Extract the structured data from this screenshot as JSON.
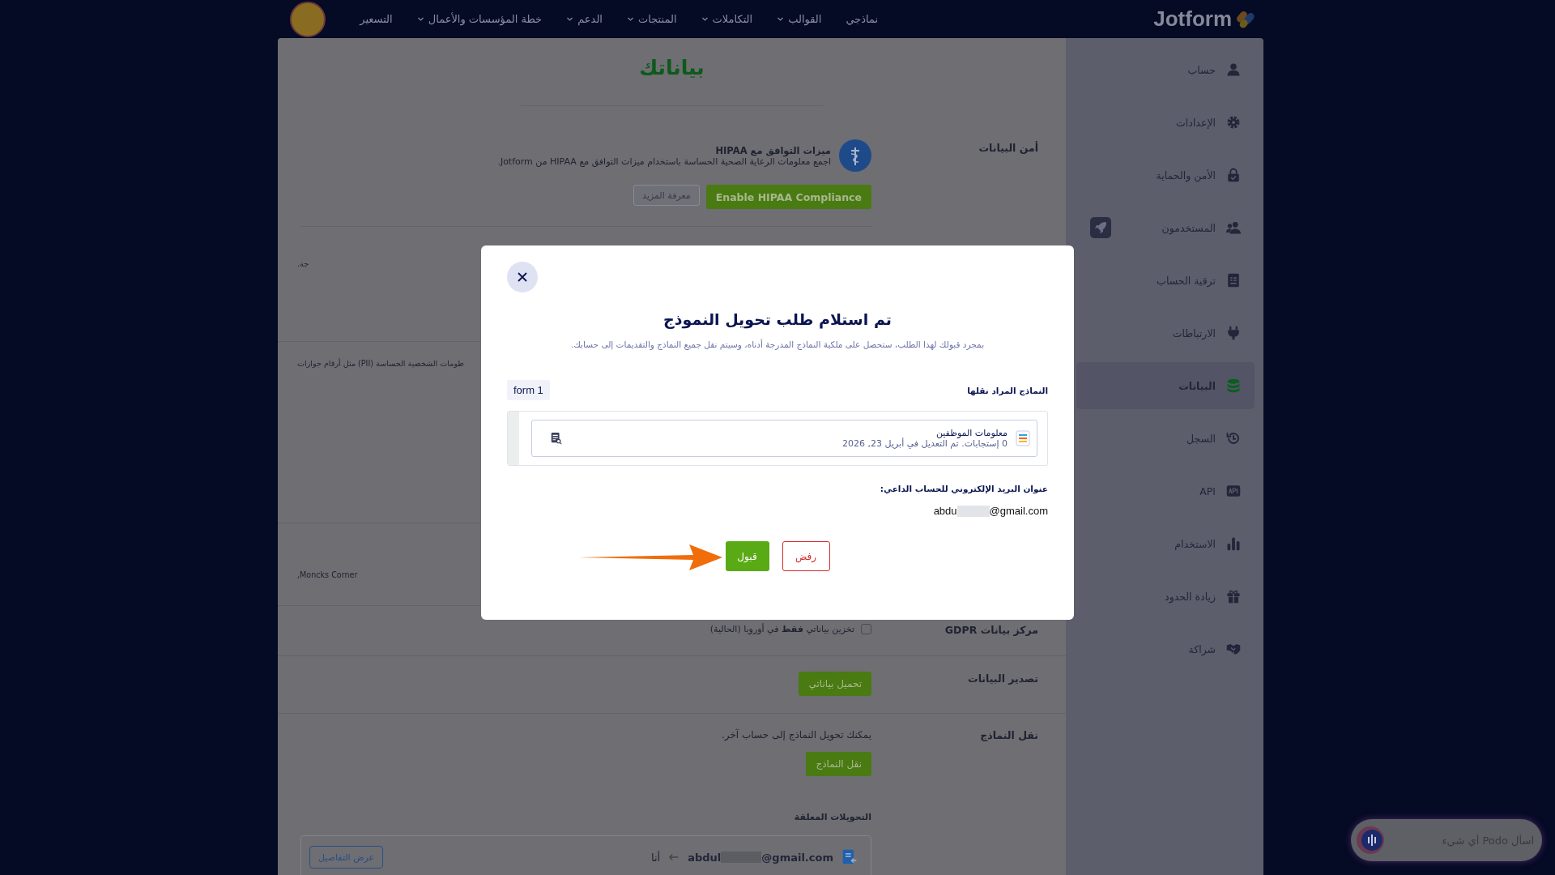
{
  "nav": {
    "logo": "Jotform",
    "items": [
      {
        "label": "نماذجي",
        "dropdown": false
      },
      {
        "label": "القوالب",
        "dropdown": true
      },
      {
        "label": "التكاملات",
        "dropdown": true
      },
      {
        "label": "المنتجات",
        "dropdown": true
      },
      {
        "label": "الدعم",
        "dropdown": true
      },
      {
        "label": "خطة المؤسسات والأعمال",
        "dropdown": true
      },
      {
        "label": "التسعير",
        "dropdown": false
      }
    ]
  },
  "sidebar": {
    "items": [
      {
        "label": "حساب",
        "selected": false,
        "upgrade_badge": false
      },
      {
        "label": "الإعدادات",
        "selected": false,
        "upgrade_badge": false
      },
      {
        "label": "الأمن والحماية",
        "selected": false,
        "upgrade_badge": false
      },
      {
        "label": "المستخدمون",
        "selected": false,
        "upgrade_badge": true
      },
      {
        "label": "ترقية الحساب",
        "selected": false,
        "upgrade_badge": false
      },
      {
        "label": "الارتباطات",
        "selected": false,
        "upgrade_badge": false
      },
      {
        "label": "البيانات",
        "selected": true,
        "upgrade_badge": false
      },
      {
        "label": "السجل",
        "selected": false,
        "upgrade_badge": false
      },
      {
        "label": "API",
        "selected": false,
        "upgrade_badge": false
      },
      {
        "label": "الاستخدام",
        "selected": false,
        "upgrade_badge": false
      },
      {
        "label": "زيادة الحدود",
        "selected": false,
        "upgrade_badge": false
      },
      {
        "label": "شراكة",
        "selected": false,
        "upgrade_badge": false
      }
    ]
  },
  "page": {
    "title": "بياناتك"
  },
  "sections": [
    {
      "kind": "hipaa",
      "heading": "أمن البيانات",
      "title": "ميزات التوافق مع HIPAA",
      "text": "اجمع معلومات الرعاية الصحية الحساسة باستخدام ميزات التوافق مع HIPAA من Jotform.",
      "primary_button": "Enable HIPAA Compliance",
      "secondary_button": "معرفة المزيد"
    },
    {
      "kind": "fragment",
      "text": "جة."
    },
    {
      "kind": "fragment",
      "text": "طومات الشخصية الحساسة (PII) مثل أرقام جوازات"
    },
    {
      "kind": "fragment",
      "text": "Moncks Corner,"
    },
    {
      "kind": "checkbox",
      "heading": "مركز بيانات GDPR",
      "label": "تخزين بياناتي **فقط** في أوروبا (الحالية)",
      "checked": false
    },
    {
      "kind": "button",
      "heading": "تصدير البيانات",
      "button": "تحميل بياناتي"
    },
    {
      "kind": "transfer",
      "heading": "نقل النماذج",
      "text": "يمكنك تحويل النماذج إلى حساب آخر.",
      "button": "نقل النماذج",
      "pending_label": "التحويلات المعلقة",
      "pending": [
        {
          "email_start": "abdul",
          "email_end": "@gmail.com",
          "recipient": "أنا",
          "button": "عرض التفاصيل"
        }
      ]
    }
  ],
  "modal": {
    "title": "تم استلام طلب تحويل النموذج",
    "subtitle": "بمجرد قبولك لهذا الطلب، ستحصل على ملكية النماذج المدرجة أدناه، وسيتم نقل جميع النماذج والتقديمات إلى حسابك.",
    "forms_label": "النماذج المراد نقلها",
    "count_chip": "form 1",
    "forms": [
      {
        "name": "معلومات الموظفين",
        "meta": "0 إستجابات. تم التعديل في أبريل 23, 2026"
      }
    ],
    "email_label": "عنوان البريد الإلكتروني للحساب الداعي:",
    "email_start": "abdu",
    "email_end": "@gmail.com",
    "accept": "قبول",
    "reject": "رفض"
  },
  "chat": {
    "placeholder": "اسأل Podo أي شيء"
  }
}
